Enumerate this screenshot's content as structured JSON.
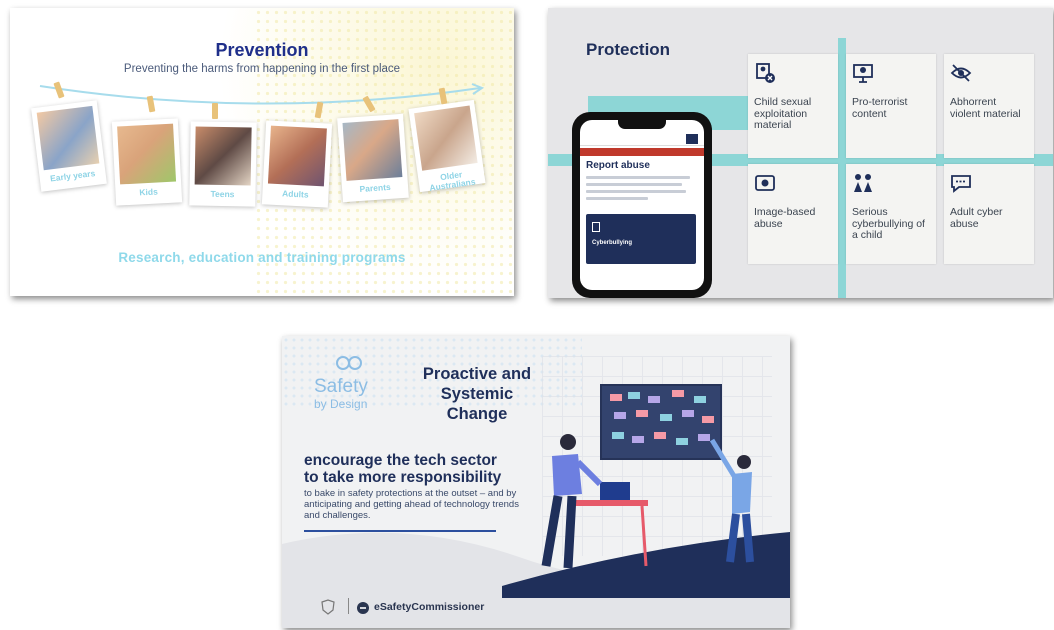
{
  "prevention": {
    "title": "Prevention",
    "subtitle": "Preventing the harms from happening in the first place",
    "photos": [
      {
        "caption": "Early years"
      },
      {
        "caption": "Kids"
      },
      {
        "caption": "Teens"
      },
      {
        "caption": "Adults"
      },
      {
        "caption": "Parents"
      },
      {
        "caption": "Older Australians"
      }
    ],
    "footer": "Research, education and training programs"
  },
  "protection": {
    "title": "Protection",
    "cards": [
      {
        "label": "Child sexual exploitation material",
        "icon": "child-safety-icon"
      },
      {
        "label": "Pro-terrorist content",
        "icon": "terrorist-content-icon"
      },
      {
        "label": "Abhorrent violent material",
        "icon": "eye-slash-icon"
      },
      {
        "label": "Image-based abuse",
        "icon": "camera-icon"
      },
      {
        "label": "Serious cyberbullying of a child",
        "icon": "children-icon"
      },
      {
        "label": "Adult cyber abuse",
        "icon": "speech-bubble-icon"
      }
    ],
    "phone": {
      "banner": "Report abuse",
      "heading": "Report abuse",
      "button": "Cyberbullying"
    }
  },
  "proactive": {
    "logo_text": "Safety",
    "logo_sub": "by Design",
    "title_lines": [
      "Proactive and",
      "Systemic",
      "Change"
    ],
    "headline_lines": [
      "encourage the tech sector",
      "to take more responsibility"
    ],
    "body": "to bake in safety protections at the outset – and by anticipating and getting ahead of technology trends and challenges.",
    "brand": "eSafetyCommissioner"
  },
  "colors": {
    "navy": "#1f2f5a",
    "teal": "#8dd6d6",
    "light_blue": "#8fd9ea"
  }
}
